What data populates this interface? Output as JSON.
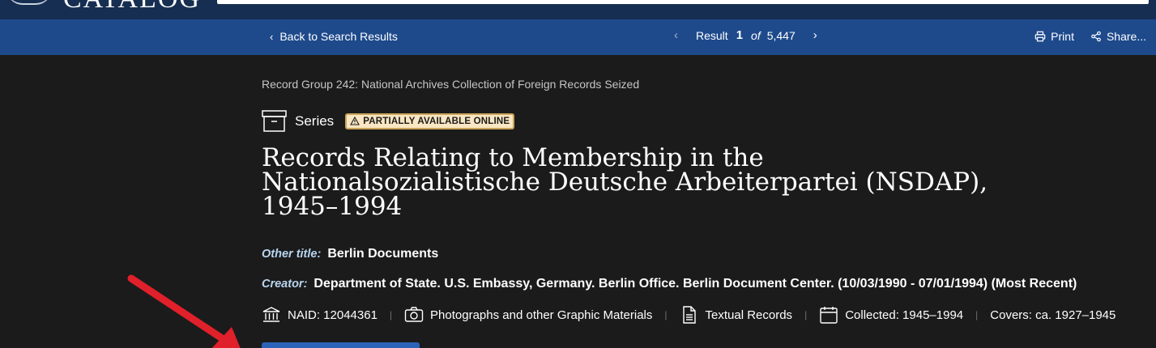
{
  "header": {
    "logo_text": "CATALOG"
  },
  "nav": {
    "back_label": "Back to Search Results",
    "result_label": "Result",
    "result_current": "1",
    "result_of": "of",
    "result_total": "5,447",
    "print_label": "Print",
    "share_label": "Share..."
  },
  "record": {
    "breadcrumb": "Record Group 242: National Archives Collection of Foreign Records Seized",
    "level": "Series",
    "availability_badge": "PARTIALLY AVAILABLE ONLINE",
    "title_line1": "Records Relating to Membership in the",
    "title_line2": "Nationalsozialistische Deutsche Arbeiterpartei (NSDAP),",
    "title_line3": "1945–1994",
    "other_title_label": "Other title:",
    "other_title_value": "Berlin Documents",
    "creator_label": "Creator:",
    "creator_value": "Department of State. U.S. Embassy, Germany. Berlin Office. Berlin Document Center. (10/03/1990 - 07/01/1994) (Most Recent)"
  },
  "facts": {
    "naid": "NAID: 12044361",
    "photos": "Photographs and other Graphic Materials",
    "textual": "Textual Records",
    "collected": "Collected: 1945–1994",
    "covers": "Covers: ca. 1927–1945"
  },
  "colors": {
    "page_bg": "#1b1b1b",
    "navbar_bg": "#1e4a8c",
    "badge_bg": "#f9e6c2",
    "annotation_arrow": "#e0202a"
  }
}
